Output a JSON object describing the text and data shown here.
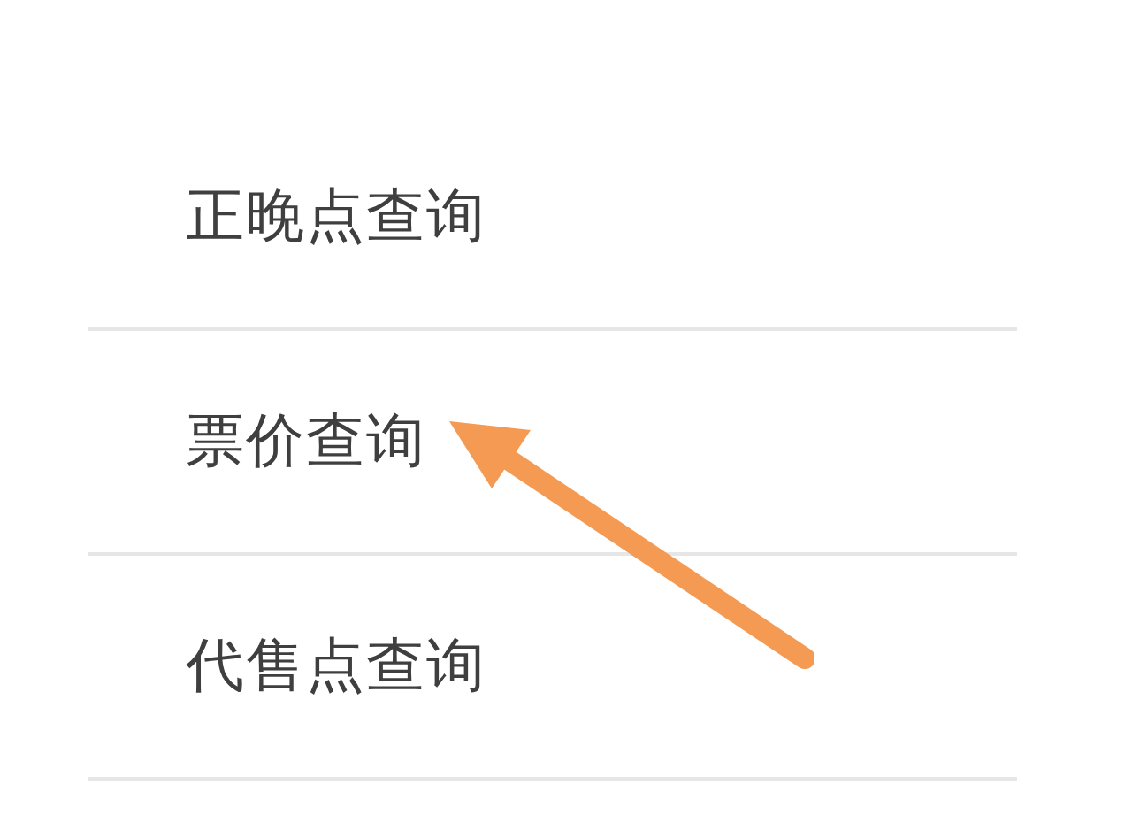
{
  "menu": {
    "items": [
      {
        "label": "正晚点查询"
      },
      {
        "label": "票价查询"
      },
      {
        "label": "代售点查询"
      }
    ]
  }
}
